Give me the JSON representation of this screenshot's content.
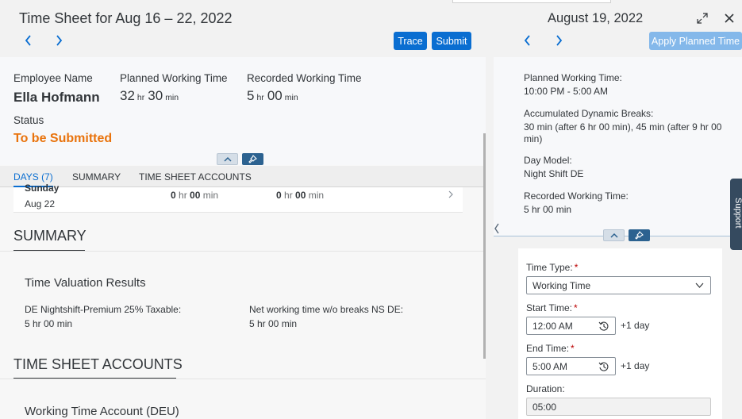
{
  "left": {
    "title": "Time Sheet for Aug 16 – 22, 2022",
    "trace_label": "Trace",
    "submit_label": "Submit",
    "header": {
      "employee_label": "Employee Name",
      "employee_name": "Ella Hofmann",
      "planned_label": "Planned Working Time",
      "planned_hr": "32",
      "planned_min": "30",
      "recorded_label": "Recorded Working Time",
      "recorded_hr": "5",
      "recorded_min": "00",
      "hr_unit": "hr",
      "min_unit": "min",
      "status_label": "Status",
      "status_value": "To be Submitted"
    },
    "tabs": [
      "DAYS (7)",
      "SUMMARY",
      "TIME SHEET ACCOUNTS"
    ],
    "day_row": {
      "day_cut": "Sunday",
      "date": "Aug 22",
      "planned_hr": "0",
      "planned_min": "00",
      "recorded_hr": "0",
      "recorded_min": "00"
    },
    "summary": {
      "title": "SUMMARY",
      "subtitle": "Time Valuation Results",
      "item1_label": "DE Nightshift-Premium 25% Taxable:",
      "item1_value": "5 hr 00 min",
      "item2_label": "Net working time w/o breaks NS DE:",
      "item2_value": "5 hr 00 min"
    },
    "accounts": {
      "title": "TIME SHEET ACCOUNTS",
      "subtitle": "Working Time Account (DEU)"
    }
  },
  "right": {
    "title": "August 19, 2022",
    "apply_label": "Apply Planned Time",
    "info": {
      "planned_label": "Planned Working Time:",
      "planned_value": "10:00 PM - 5:00 AM",
      "breaks_label": "Accumulated Dynamic Breaks:",
      "breaks_value": "30 min (after 6 hr 00 min), 45 min (after 9 hr 00 min)",
      "daymodel_label": "Day Model:",
      "daymodel_value": "Night Shift DE",
      "recorded_label": "Recorded Working Time:",
      "recorded_value": "5 hr 00 min"
    },
    "support_label": "Support",
    "form": {
      "type_label": "Time Type:",
      "type_value": "Working Time",
      "start_label": "Start Time:",
      "start_value": "12:00 AM",
      "start_plus": "+1 day",
      "end_label": "End Time:",
      "end_value": "5:00 AM",
      "end_plus": "+1 day",
      "duration_label": "Duration:",
      "duration_value": "05:00",
      "required_mark": "*"
    }
  },
  "colors": {
    "brand": "#0a6ed1",
    "status_orange": "#e9730c",
    "apply_disabled": "#84b8ea",
    "pin_dark": "#2c6290"
  },
  "icons": [
    "chevron-left-icon",
    "chevron-right-icon",
    "chevron-up-icon",
    "pin-icon",
    "expand-icon",
    "close-icon",
    "chevron-down-icon",
    "clock-reset-icon"
  ]
}
